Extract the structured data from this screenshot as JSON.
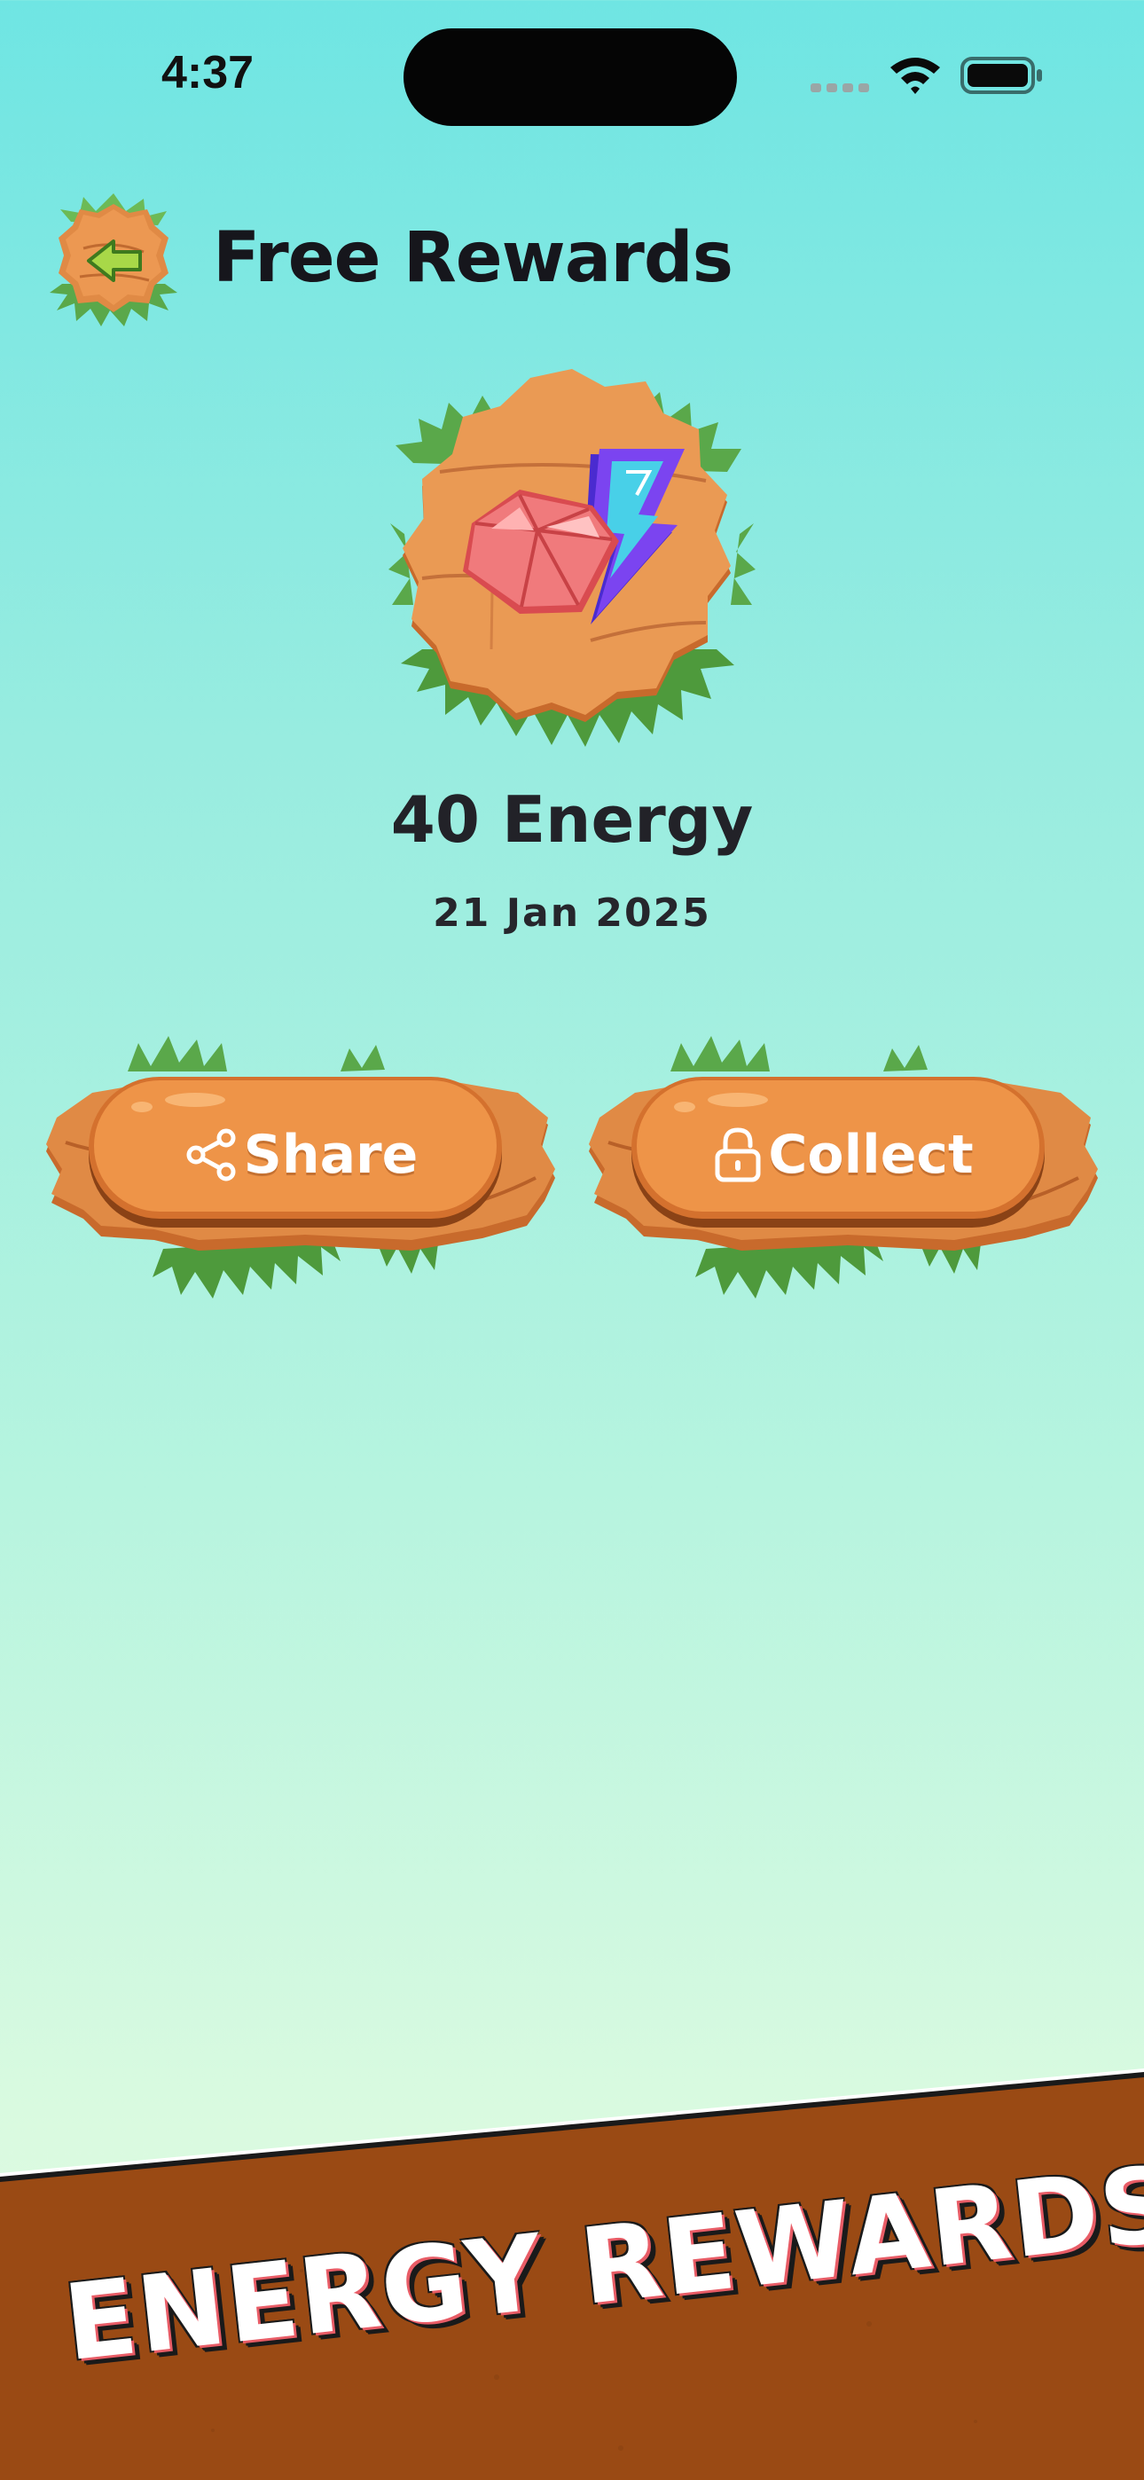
{
  "status_bar": {
    "time": "4:37",
    "icons": [
      "cellular-signal-icon",
      "wifi-icon",
      "battery-icon"
    ]
  },
  "header": {
    "back_icon": "back-arrow-icon",
    "title": "Free Rewards"
  },
  "reward": {
    "icons": [
      "gem-icon",
      "lightning-bolt-icon"
    ],
    "amount": "40 Energy",
    "date": "21 Jan 2025"
  },
  "actions": {
    "share_label": "Share",
    "share_icon": "share-icon",
    "collect_label": "Collect",
    "collect_icon": "lock-icon"
  },
  "banner": {
    "text": "ENERGY REWARDS"
  },
  "colors": {
    "background_top": "#6fe5e3",
    "background_bottom": "#e4fbe4",
    "wood": "#d97a35",
    "grass": "#5aa84a",
    "banner_brown": "#9a4a14"
  }
}
